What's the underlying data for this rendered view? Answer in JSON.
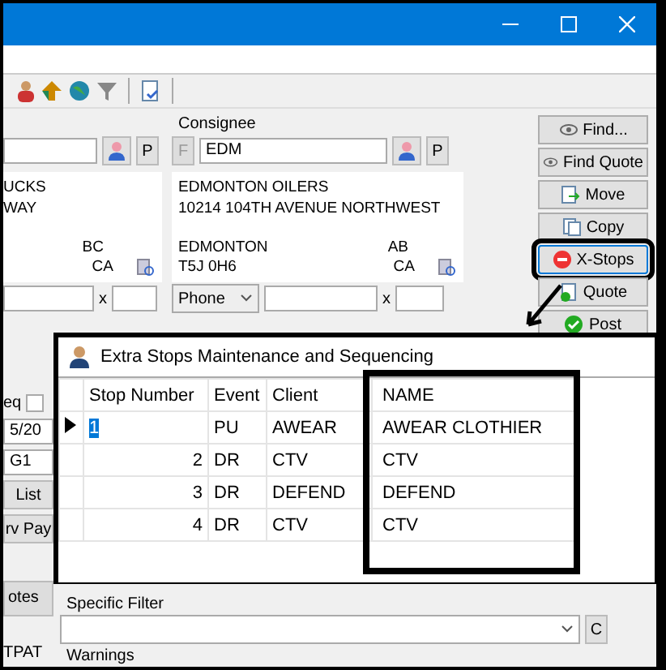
{
  "shipper": {
    "profile_button": "P",
    "name": "UCKS",
    "address": "WAY",
    "state": "BC",
    "country": "CA",
    "phone_separator": "x"
  },
  "consignee": {
    "label": "Consignee",
    "flag_button": "F",
    "code": "EDM",
    "profile_button": "P",
    "name": "EDMONTON OILERS",
    "address": "10214 104TH AVENUE NORTHWEST",
    "city": "EDMONTON",
    "state": "AB",
    "postal": "T5J 0H6",
    "country": "CA",
    "contact_type": "Phone",
    "phone_separator": "x"
  },
  "actions": [
    {
      "label": "Find...",
      "kind": "eye",
      "highlighted": false
    },
    {
      "label": "Find Quote",
      "kind": "eye",
      "highlighted": false
    },
    {
      "label": "Move",
      "kind": "move",
      "highlighted": false
    },
    {
      "label": "Copy",
      "kind": "copy",
      "highlighted": false
    },
    {
      "label": "X-Stops",
      "kind": "stop",
      "highlighted": true
    },
    {
      "label": "Quote",
      "kind": "doccheck",
      "highlighted": false
    },
    {
      "label": "Post",
      "kind": "check",
      "highlighted": false
    }
  ],
  "left_fields": {
    "req_label": "eq",
    "req_checked": false,
    "date": "5/20",
    "code": "G1",
    "list_button": "List",
    "drv_pay_button": "rv Pay",
    "notes_tab": "otes",
    "tpat_label": "TPAT"
  },
  "filter": {
    "label": "Specific Filter",
    "clear_button": "C",
    "warnings_label": "Warnings"
  },
  "dialog": {
    "title": "Extra Stops Maintenance and Sequencing",
    "columns": [
      "Stop Number",
      "Event",
      "Client",
      "NAME"
    ],
    "rows": [
      {
        "stop": "1",
        "event": "PU",
        "client": "AWEAR",
        "name": "AWEAR CLOTHIER",
        "selected": true
      },
      {
        "stop": "2",
        "event": "DR",
        "client": "CTV",
        "name": "CTV",
        "selected": false
      },
      {
        "stop": "3",
        "event": "DR",
        "client": "DEFEND",
        "name": "DEFEND",
        "selected": false
      },
      {
        "stop": "4",
        "event": "DR",
        "client": "CTV",
        "name": "CTV",
        "selected": false
      }
    ]
  }
}
